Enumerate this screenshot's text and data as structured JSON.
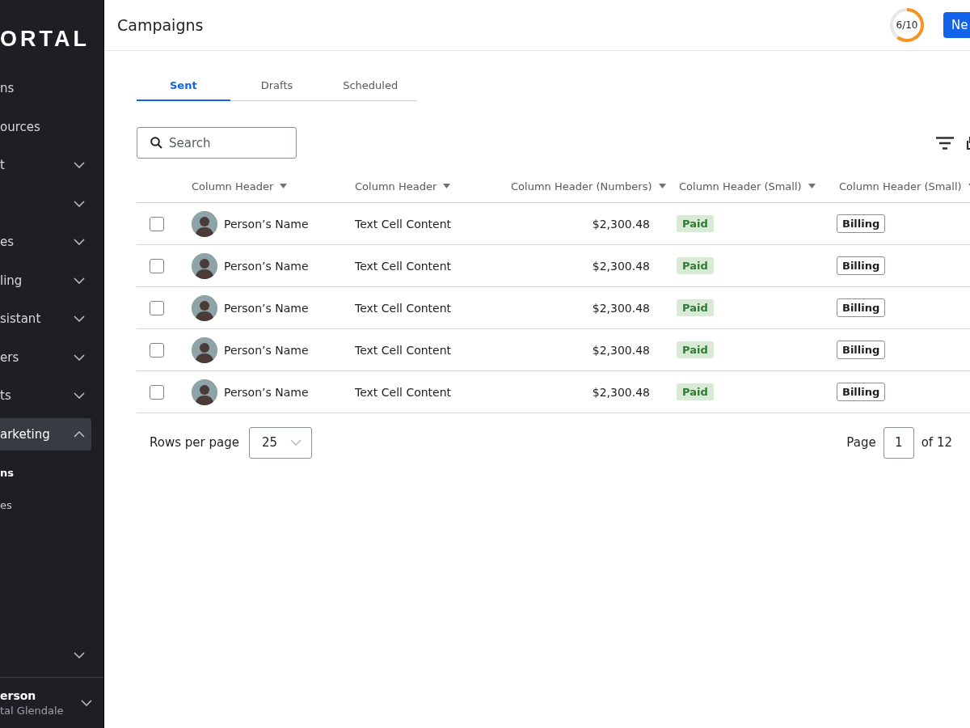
{
  "sidebar": {
    "logo": "ORTAL",
    "items": [
      {
        "label": "ns",
        "kind": "link",
        "selected": false
      },
      {
        "label": "ources",
        "kind": "link",
        "selected": false
      },
      {
        "label": "t",
        "kind": "group",
        "expanded": false,
        "selected": false
      },
      {
        "kind": "group",
        "expanded": false,
        "selected": false
      },
      {
        "label": "es",
        "kind": "group",
        "expanded": false,
        "selected": false
      },
      {
        "label": "ling",
        "kind": "group",
        "expanded": false,
        "selected": false
      },
      {
        "label": "sistant",
        "kind": "group",
        "expanded": false,
        "selected": false
      },
      {
        "label": "ers",
        "kind": "group",
        "expanded": false,
        "selected": false
      },
      {
        "label": "ts",
        "kind": "group",
        "expanded": false,
        "selected": false
      },
      {
        "label": "arketing",
        "kind": "group",
        "expanded": true,
        "selected": true,
        "children": [
          {
            "label": "ns",
            "selected": true
          },
          {
            "label": "es",
            "selected": false
          }
        ]
      }
    ],
    "bottom_items": [
      {
        "kind": "group",
        "expanded": false,
        "selected": false
      }
    ],
    "user": {
      "name": "erson",
      "org": "tal Glendale"
    }
  },
  "header": {
    "title": "Campaigns",
    "progress": {
      "label": "6/10",
      "level": 0.6
    },
    "new_button": "Ne"
  },
  "tabs": [
    {
      "label": "Sent",
      "selected": true
    },
    {
      "label": "Drafts",
      "selected": false
    },
    {
      "label": "Scheduled",
      "selected": false
    }
  ],
  "search": {
    "placeholder": "Search"
  },
  "table": {
    "columns": [
      {
        "label": "Column Header",
        "kind": "text"
      },
      {
        "label": "Column Header",
        "kind": "text"
      },
      {
        "label": "Column Header (Numbers)",
        "kind": "number"
      },
      {
        "label": "Column Header (Small)",
        "kind": "text"
      },
      {
        "label": "Column Header (Small)",
        "kind": "text"
      }
    ],
    "rows": [
      {
        "checked": false,
        "name": "Person’s Name",
        "text": "Text Cell Content",
        "amount": "$2,300.48",
        "status": "Paid",
        "tag": "Billing"
      },
      {
        "checked": false,
        "name": "Person’s Name",
        "text": "Text Cell Content",
        "amount": "$2,300.48",
        "status": "Paid",
        "tag": "Billing"
      },
      {
        "checked": false,
        "name": "Person’s Name",
        "text": "Text Cell Content",
        "amount": "$2,300.48",
        "status": "Paid",
        "tag": "Billing"
      },
      {
        "checked": false,
        "name": "Person’s Name",
        "text": "Text Cell Content",
        "amount": "$2,300.48",
        "status": "Paid",
        "tag": "Billing"
      },
      {
        "checked": false,
        "name": "Person’s Name",
        "text": "Text Cell Content",
        "amount": "$2,300.48",
        "status": "Paid",
        "tag": "Billing"
      }
    ]
  },
  "pagination": {
    "rows_label": "Rows per page",
    "rows_value": "25",
    "page_label": "Page",
    "page_value": "1",
    "of_label": "of 12"
  }
}
